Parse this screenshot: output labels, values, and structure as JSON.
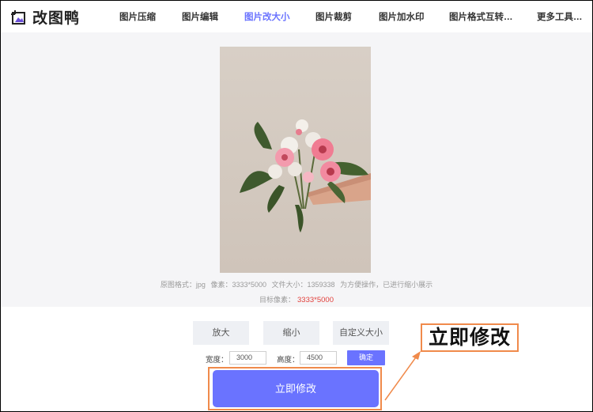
{
  "header": {
    "logo_text": "改图鸭",
    "nav": [
      {
        "label": "图片压缩"
      },
      {
        "label": "图片编辑"
      },
      {
        "label": "图片改大小"
      },
      {
        "label": "图片裁剪"
      },
      {
        "label": "图片加水印"
      },
      {
        "label": "图片格式互转…"
      },
      {
        "label": "更多工具…"
      }
    ],
    "active_index": 2
  },
  "preview": {
    "info": {
      "format_label": "原图格式：jpg",
      "pixels_label": "像素：3333*5000",
      "size_label": "文件大小：1359338",
      "note": "为方便操作，已进行缩小展示"
    },
    "target_label": "目标像素：",
    "target_value": "3333*5000"
  },
  "controls": {
    "enlarge": "放大",
    "shrink": "缩小",
    "custom": "自定义大小",
    "width_label": "宽度：",
    "width_value": "3000",
    "height_label": "高度：",
    "height_value": "4500",
    "confirm": "确定",
    "submit": "立即修改"
  },
  "annotation": {
    "callout_text": "立即修改"
  },
  "colors": {
    "accent": "#6a73ff",
    "highlight": "#f08a4b",
    "target": "#e2403c"
  }
}
